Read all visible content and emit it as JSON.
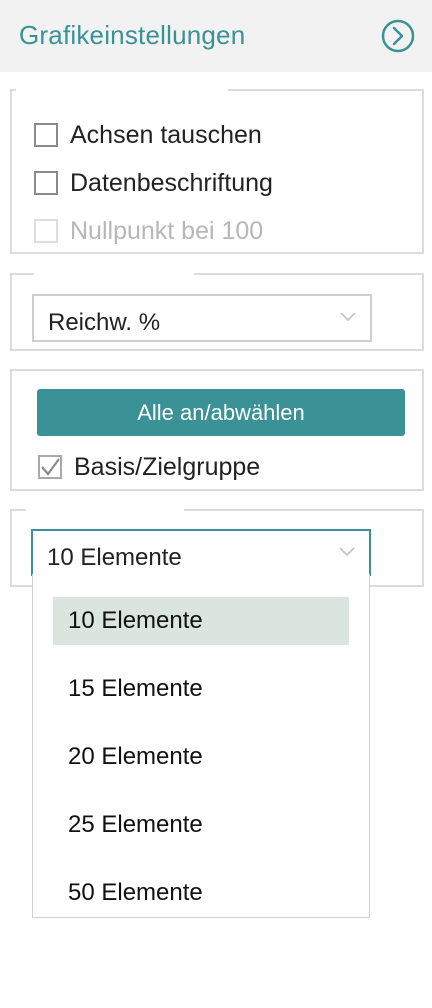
{
  "header": {
    "title": "Grafikeinstellungen",
    "action_icon": "chevron-right-circle-icon"
  },
  "options": {
    "swap_axes": {
      "label": "Achsen tauschen",
      "checked": false,
      "enabled": true
    },
    "data_labels": {
      "label": "Datenbeschriftung",
      "checked": false,
      "enabled": true
    },
    "zero_at_100": {
      "label": "Nullpunkt bei 100",
      "checked": false,
      "enabled": false
    }
  },
  "metric_select": {
    "value": "Reichw. %"
  },
  "selection": {
    "select_all_label": "Alle an/abwählen",
    "base_target": {
      "label": "Basis/Zielgruppe",
      "checked": true
    }
  },
  "elements_select": {
    "value": "10 Elemente",
    "expanded": true,
    "options": [
      "10 Elemente",
      "15 Elemente",
      "20 Elemente",
      "25 Elemente",
      "50 Elemente"
    ],
    "selected_index": 0
  },
  "colors": {
    "accent": "#3a9196",
    "header_bg": "#f2f2f2",
    "selected_option_bg": "#dae5df",
    "border": "#dcdcdc"
  }
}
